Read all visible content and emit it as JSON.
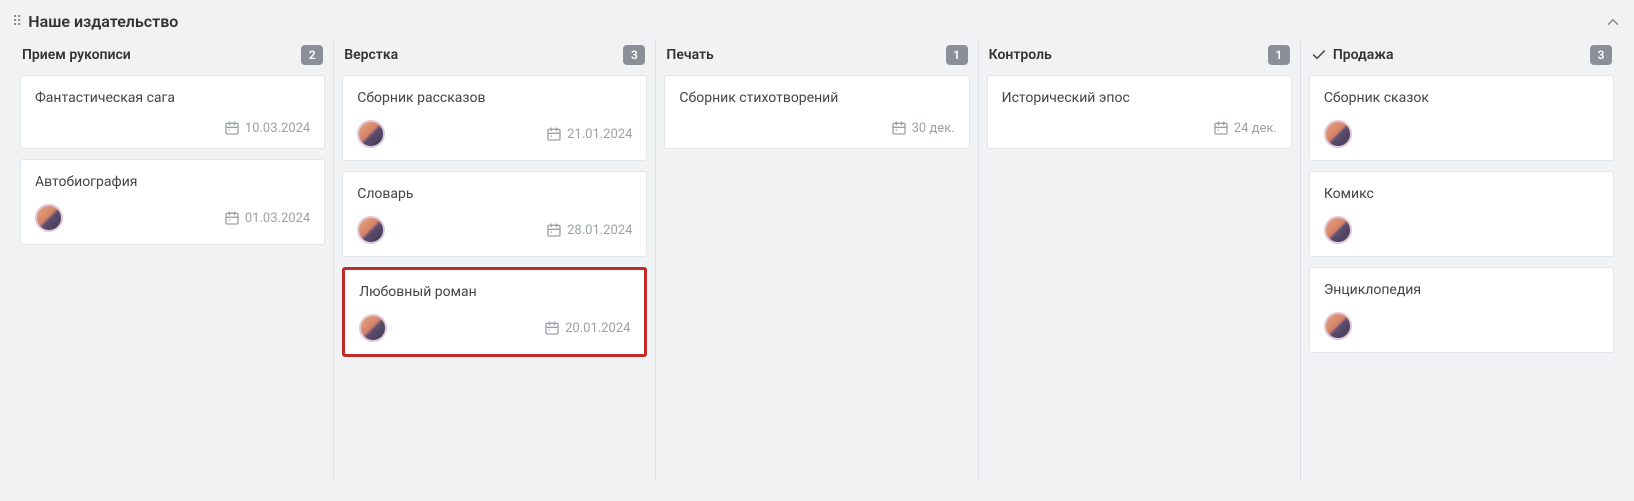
{
  "board": {
    "title": "Наше издательство"
  },
  "columns": [
    {
      "title": "Прием рукописи",
      "count": "2",
      "has_check": false,
      "cards": [
        {
          "title": "Фантастическая сага",
          "date": "10.03.2024",
          "has_avatar": false,
          "highlighted": false
        },
        {
          "title": "Автобиография",
          "date": "01.03.2024",
          "has_avatar": true,
          "highlighted": false
        }
      ]
    },
    {
      "title": "Верстка",
      "count": "3",
      "has_check": false,
      "cards": [
        {
          "title": "Сборник рассказов",
          "date": "21.01.2024",
          "has_avatar": true,
          "highlighted": false
        },
        {
          "title": "Словарь",
          "date": "28.01.2024",
          "has_avatar": true,
          "highlighted": false
        },
        {
          "title": "Любовный роман",
          "date": "20.01.2024",
          "has_avatar": true,
          "highlighted": true
        }
      ]
    },
    {
      "title": "Печать",
      "count": "1",
      "has_check": false,
      "cards": [
        {
          "title": "Сборник стихотворений",
          "date": "30 дек.",
          "has_avatar": false,
          "highlighted": false
        }
      ]
    },
    {
      "title": "Контроль",
      "count": "1",
      "has_check": false,
      "cards": [
        {
          "title": "Исторический эпос",
          "date": "24 дек.",
          "has_avatar": false,
          "highlighted": false
        }
      ]
    },
    {
      "title": "Продажа",
      "count": "3",
      "has_check": true,
      "cards": [
        {
          "title": "Сборник сказок",
          "date": "",
          "has_avatar": true,
          "highlighted": false
        },
        {
          "title": "Комикс",
          "date": "",
          "has_avatar": true,
          "highlighted": false
        },
        {
          "title": "Энциклопедия",
          "date": "",
          "has_avatar": true,
          "highlighted": false
        }
      ]
    }
  ]
}
